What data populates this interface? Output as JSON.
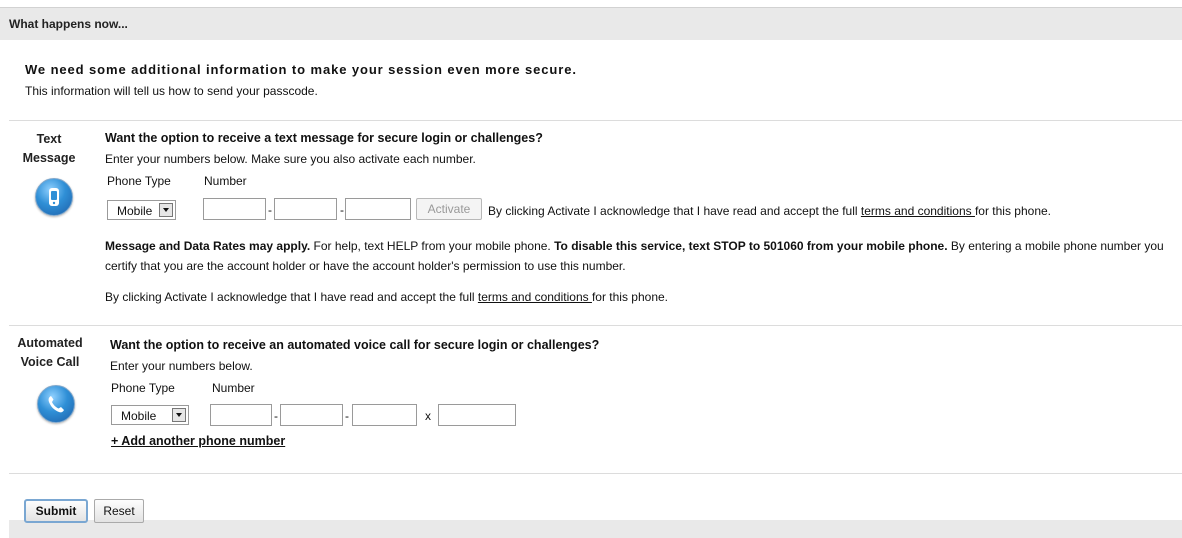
{
  "header": {
    "title": "What happens now..."
  },
  "intro": {
    "heading": "We need some additional information to make your session even more secure.",
    "subtext": "This information will tell us how to send your passcode."
  },
  "text_message": {
    "label_line1": "Text",
    "label_line2": "Message",
    "icon": "mobile-phone-icon",
    "question": "Want the option to receive a text message for secure login or challenges?",
    "instructions": "Enter your numbers below. Make sure you also activate each number.",
    "phone_type_header": "Phone Type",
    "number_header": "Number",
    "phone_type_value": "Mobile",
    "activate_label": "Activate",
    "ack_prefix": "By clicking Activate I acknowledge that I have read and accept the full ",
    "terms_link": "terms and conditions ",
    "ack_suffix": "for this phone.",
    "rates_bold": "Message and Data Rates may apply.",
    "rates_help": " For help, text HELP from your mobile phone. ",
    "disable_bold": "To disable this service, text STOP to 501060 from your mobile phone.",
    "certify": " By entering a mobile phone number you certify that you are the account holder or have the account holder's permission to use this number.",
    "ack2_prefix": "By clicking Activate I acknowledge that I have read and accept the full ",
    "terms_link2": "terms and conditions ",
    "ack2_suffix": "for this phone."
  },
  "voice_call": {
    "label_line1": "Automated",
    "label_line2": "Voice Call",
    "icon": "phone-handset-icon",
    "question": "Want the option to receive an automated voice call for secure login or challenges?",
    "instructions": "Enter your numbers below.",
    "phone_type_header": "Phone Type",
    "number_header": "Number",
    "phone_type_value": "Mobile",
    "extension_separator": "x",
    "add_link": "+ Add another phone number"
  },
  "actions": {
    "submit_label": "Submit",
    "reset_label": "Reset"
  },
  "colors": {
    "accent": "#2f8fd6",
    "header_bg": "#e9e9e9"
  }
}
